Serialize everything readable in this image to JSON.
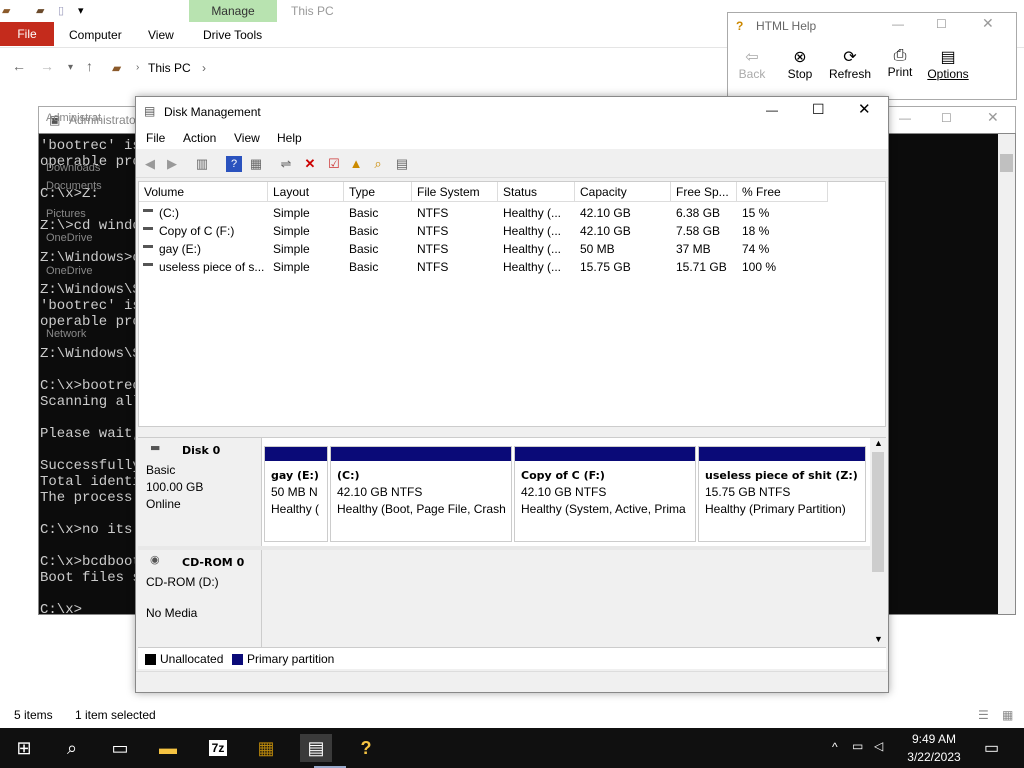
{
  "explorer": {
    "context_tab": "Manage",
    "title": "This PC",
    "ribbon_tabs": [
      "File",
      "Computer",
      "View",
      "Drive Tools"
    ],
    "address": "This PC",
    "status_items": "5 items",
    "status_selected": "1 item selected",
    "side_items": [
      "Administrat",
      "Downloads",
      "Documents",
      "Pictures",
      "OneDrive",
      "OneDrive",
      "Network"
    ]
  },
  "cmd": {
    "title": "Administrator",
    "lines": [
      "'bootrec' is",
      "operable pro",
      "",
      "C:\\x>Z:",
      "",
      "Z:\\>cd windo",
      "",
      "Z:\\Windows>c",
      "",
      "Z:\\Windows\\S",
      "'bootrec' is",
      "operable pro",
      "",
      "Z:\\Windows\\S",
      "",
      "C:\\x>bootrec",
      "Scanning all",
      "",
      "Please wait,",
      "",
      "Successfully",
      "Total identi",
      "The process",
      "",
      "C:\\x>no its",
      "",
      "C:\\x>bcdboot",
      "Boot files s",
      "",
      "C:\\x>"
    ]
  },
  "help": {
    "title": "HTML Help",
    "buttons": [
      "Back",
      "Stop",
      "Refresh",
      "Print",
      "Options"
    ]
  },
  "dm": {
    "title": "Disk Management",
    "menu": [
      "File",
      "Action",
      "View",
      "Help"
    ],
    "columns": [
      "Volume",
      "Layout",
      "Type",
      "File System",
      "Status",
      "Capacity",
      "Free Sp...",
      "% Free"
    ],
    "rows": [
      [
        "(C:)",
        "Simple",
        "Basic",
        "NTFS",
        "Healthy (...",
        "42.10 GB",
        "6.38 GB",
        "15 %"
      ],
      [
        "Copy of C (F:)",
        "Simple",
        "Basic",
        "NTFS",
        "Healthy (...",
        "42.10 GB",
        "7.58 GB",
        "18 %"
      ],
      [
        "gay (E:)",
        "Simple",
        "Basic",
        "NTFS",
        "Healthy (...",
        "50 MB",
        "37 MB",
        "74 %"
      ],
      [
        "useless piece of s...",
        "Simple",
        "Basic",
        "NTFS",
        "Healthy (...",
        "15.75 GB",
        "15.71 GB",
        "100 %"
      ]
    ],
    "disk0": {
      "name": "Disk 0",
      "type": "Basic",
      "size": "100.00 GB",
      "state": "Online",
      "partitions": [
        {
          "name": "gay  (E:)",
          "size": "50 MB N",
          "status": "Healthy ("
        },
        {
          "name": "(C:)",
          "size": "42.10 GB NTFS",
          "status": "Healthy (Boot, Page File, Crash"
        },
        {
          "name": "Copy of C  (F:)",
          "size": "42.10 GB NTFS",
          "status": "Healthy (System, Active, Prima"
        },
        {
          "name": "useless piece of shit  (Z:)",
          "size": "15.75 GB NTFS",
          "status": "Healthy (Primary Partition)"
        }
      ]
    },
    "cdrom": {
      "name": "CD-ROM 0",
      "drive": "CD-ROM (D:)",
      "media": "No Media"
    },
    "legend": [
      "Unallocated",
      "Primary partition"
    ],
    "colors": {
      "unallocated": "#000000",
      "primary": "#0a0a78"
    }
  },
  "taskbar": {
    "time": "9:49 AM",
    "date": "3/22/2023",
    "apps": [
      "start",
      "search",
      "task-view",
      "file-explorer",
      "7-zip",
      "winrar",
      "disk-management",
      "html-help"
    ]
  }
}
